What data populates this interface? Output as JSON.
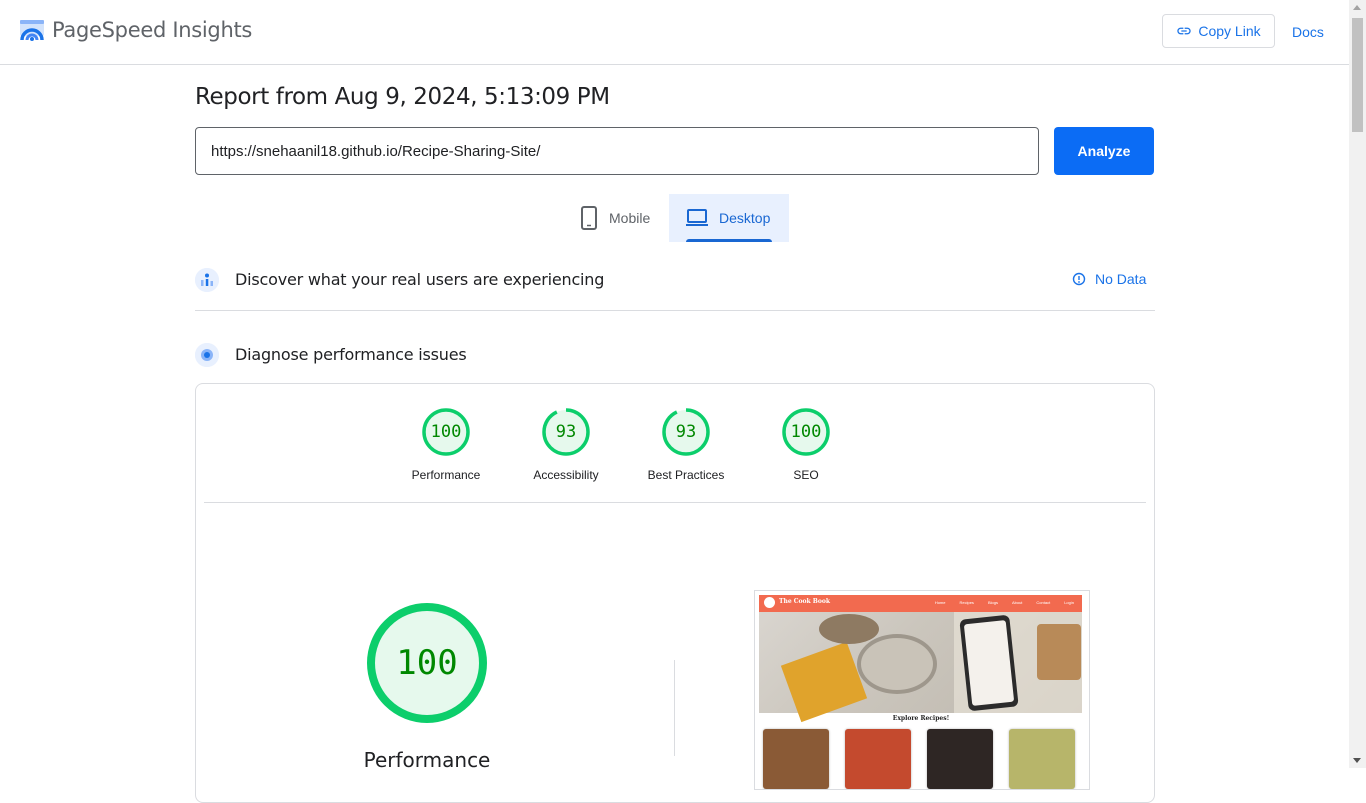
{
  "header": {
    "app_title": "PageSpeed Insights",
    "copy_link_label": "Copy Link",
    "docs_label": "Docs"
  },
  "report": {
    "title": "Report from Aug 9, 2024, 5:13:09 PM",
    "url_value": "https://snehaanil18.github.io/Recipe-Sharing-Site/",
    "analyze_label": "Analyze"
  },
  "tabs": [
    {
      "label": "Mobile",
      "icon": "smartphone-icon",
      "selected": false
    },
    {
      "label": "Desktop",
      "icon": "laptop-icon",
      "selected": true
    }
  ],
  "field_data": {
    "title": "Discover what your real users are experiencing",
    "status": "No Data"
  },
  "lab_data": {
    "title": "Diagnose performance issues"
  },
  "scores": [
    {
      "label": "Performance",
      "value": "100",
      "fraction": 1.0
    },
    {
      "label": "Accessibility",
      "value": "93",
      "fraction": 0.93
    },
    {
      "label": "Best Practices",
      "value": "93",
      "fraction": 0.93
    },
    {
      "label": "SEO",
      "value": "100",
      "fraction": 1.0
    }
  ],
  "main_score": {
    "value": "100",
    "label": "Performance",
    "fraction": 1.0
  },
  "screenshot": {
    "brand": "The Cook Book",
    "nav_links": [
      "Home",
      "Recipes",
      "Blogs",
      "About",
      "Contact",
      "Login"
    ],
    "caption": "Explore Recipes!"
  },
  "colors": {
    "accent": "#1a73e8",
    "pass": "#0cce6b",
    "pass_fill": "#e6f9ed",
    "pass_text": "#008800"
  }
}
